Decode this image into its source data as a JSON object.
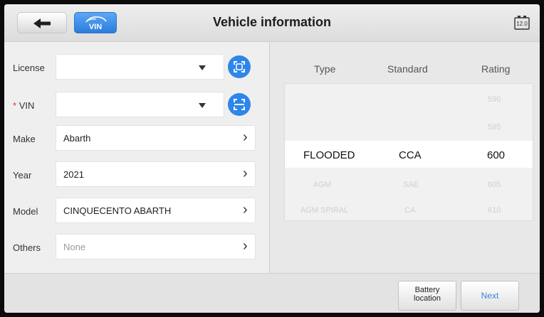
{
  "header": {
    "title": "Vehicle information",
    "back_icon": "arrow-left-icon",
    "vin_badge": "VIN",
    "battery_value": "12.0"
  },
  "form": {
    "license": {
      "label": "License",
      "value": "",
      "placeholder": ""
    },
    "vin": {
      "required_mark": "*",
      "label": "VIN",
      "value": "",
      "placeholder": ""
    },
    "make": {
      "label": "Make",
      "value": "Abarth"
    },
    "year": {
      "label": "Year",
      "value": "2021"
    },
    "model": {
      "label": "Model",
      "value": "CINQUECENTO ABARTH"
    },
    "others": {
      "label": "Others",
      "placeholder": "None"
    }
  },
  "battery_table": {
    "columns": [
      "Type",
      "Standard",
      "Rating"
    ],
    "rows": [
      {
        "type": "",
        "standard": "",
        "rating": "590"
      },
      {
        "type": "",
        "standard": "",
        "rating": "595"
      },
      {
        "type": "FLOODED",
        "standard": "CCA",
        "rating": "600",
        "selected": true
      },
      {
        "type": "AGM",
        "standard": "SAE",
        "rating": "605"
      },
      {
        "type": "AGM SPIRAL",
        "standard": "CA",
        "rating": "610"
      }
    ]
  },
  "footer": {
    "battery_location_line1": "Battery",
    "battery_location_line2": "location",
    "next_label": "Next"
  },
  "colors": {
    "accent": "#2d86ea",
    "required": "#e03030"
  }
}
